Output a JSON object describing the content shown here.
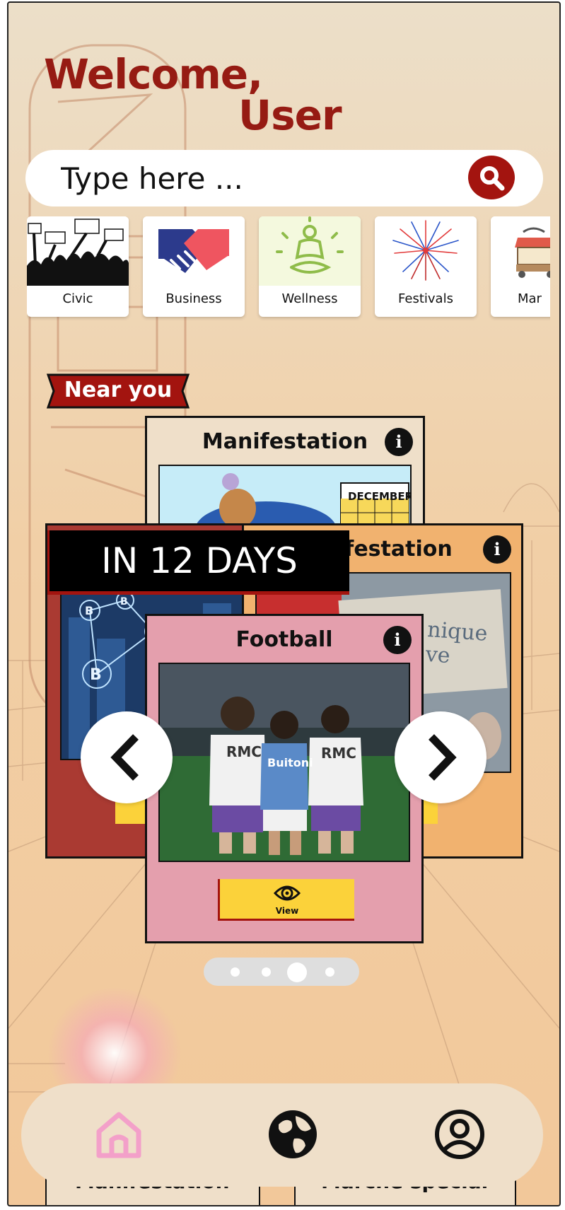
{
  "welcome": {
    "line1": "Welcome,",
    "line2": "User"
  },
  "search": {
    "placeholder": "Type here ..."
  },
  "categories": [
    {
      "label": "Civic",
      "icon": "crowd-protest-icon"
    },
    {
      "label": "Business",
      "icon": "handshake-icon"
    },
    {
      "label": "Wellness",
      "icon": "meditation-icon"
    },
    {
      "label": "Festivals",
      "icon": "fireworks-icon"
    },
    {
      "label": "Mar",
      "icon": "market-stall-icon"
    }
  ],
  "near_you": {
    "label": "Near you"
  },
  "cards": {
    "back": {
      "title": "Manifestation",
      "calendar_text": "DECEMBER"
    },
    "right": {
      "title": "ifestation",
      "sign_text": "nique ve"
    },
    "front": {
      "title": "Football",
      "view_label": "View",
      "jersey_left": "RMC",
      "jersey_mid": "Buitoni",
      "jersey_right": "RMC"
    },
    "countdown": "IN 12 DAYS"
  },
  "pagination": {
    "active_index": 2,
    "count": 4
  },
  "bottom_peek": {
    "left": "Manifestation",
    "right": "Marche special"
  },
  "nav": {
    "items": [
      "home-icon",
      "globe-icon",
      "profile-icon"
    ],
    "active": "home-icon"
  },
  "colors": {
    "brand": "#961b13",
    "accent_yellow": "#fbd23a",
    "card_pink": "#e49fad",
    "card_orange": "#f1b26f",
    "card_red": "#aa3a32",
    "nav_active": "#f3a0c9"
  }
}
